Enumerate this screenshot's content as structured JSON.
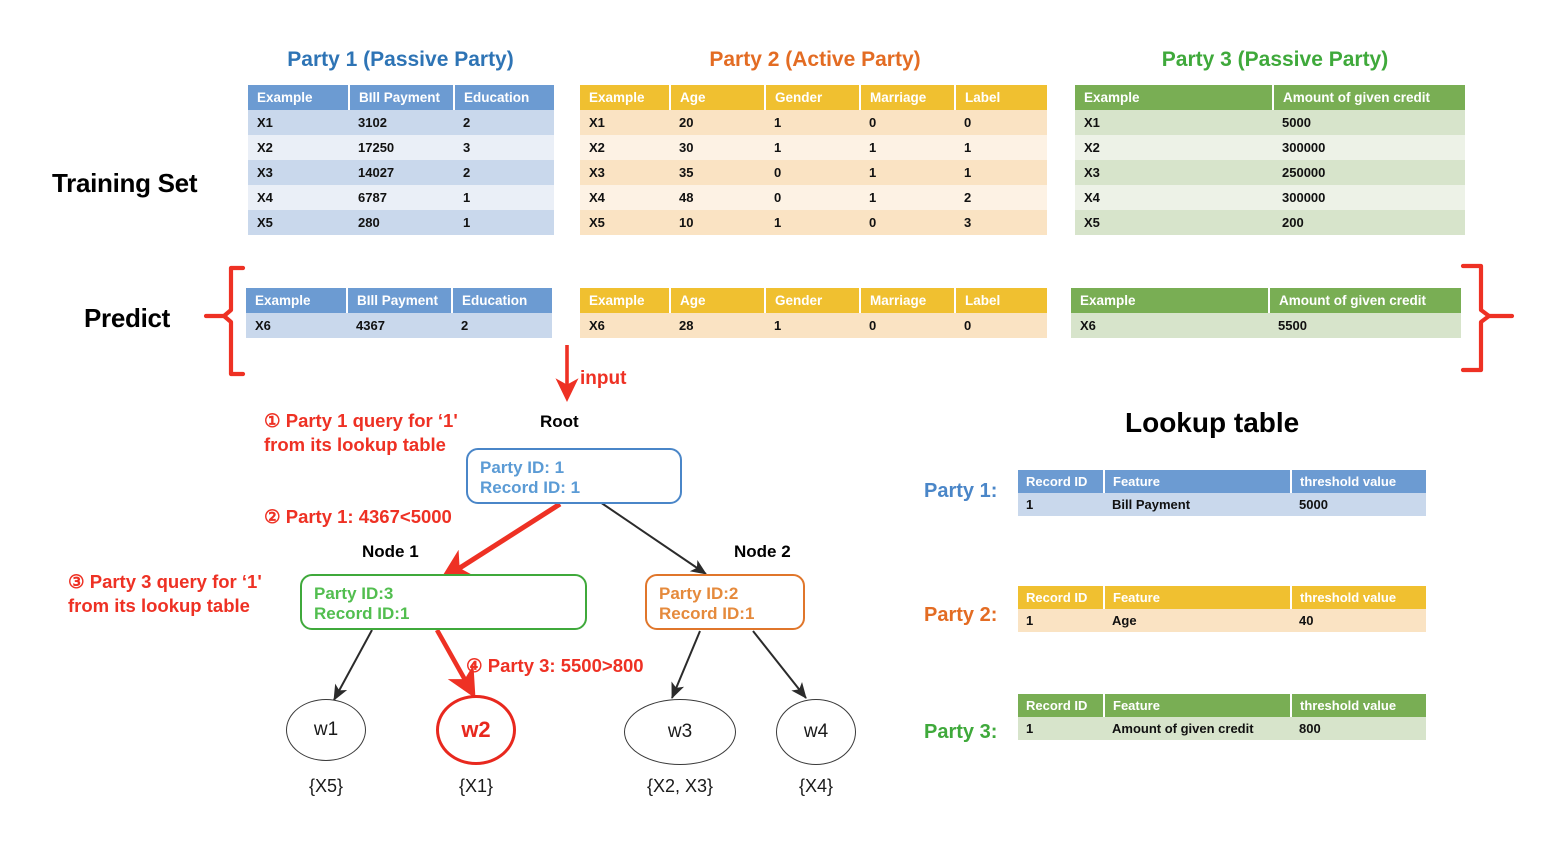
{
  "row_labels": {
    "training_set": "Training Set",
    "predict": "Predict"
  },
  "parties": [
    {
      "title": "Party 1 (Passive Party)",
      "theme": "blue",
      "columns": [
        "Example",
        "BIll Payment",
        "Education"
      ],
      "rows": [
        [
          "X1",
          "3102",
          "2"
        ],
        [
          "X2",
          "17250",
          "3"
        ],
        [
          "X3",
          "14027",
          "2"
        ],
        [
          "X4",
          "6787",
          "1"
        ],
        [
          "X5",
          "280",
          "1"
        ]
      ],
      "predict_rows": [
        [
          "X6",
          "4367",
          "2"
        ]
      ]
    },
    {
      "title": "Party 2 (Active Party)",
      "theme": "yellow",
      "columns": [
        "Example",
        "Age",
        "Gender",
        "Marriage",
        "Label"
      ],
      "rows": [
        [
          "X1",
          "20",
          "1",
          "0",
          "0"
        ],
        [
          "X2",
          "30",
          "1",
          "1",
          "1"
        ],
        [
          "X3",
          "35",
          "0",
          "1",
          "1"
        ],
        [
          "X4",
          "48",
          "0",
          "1",
          "2"
        ],
        [
          "X5",
          "10",
          "1",
          "0",
          "3"
        ]
      ],
      "predict_rows": [
        [
          "X6",
          "28",
          "1",
          "0",
          "0"
        ]
      ]
    },
    {
      "title": "Party 3 (Passive Party)",
      "theme": "green",
      "columns": [
        "Example",
        "Amount of given credit"
      ],
      "rows": [
        [
          "X1",
          "5000"
        ],
        [
          "X2",
          "300000"
        ],
        [
          "X3",
          "250000"
        ],
        [
          "X4",
          "300000"
        ],
        [
          "X5",
          "200"
        ]
      ],
      "predict_rows": [
        [
          "X6",
          "5500"
        ]
      ]
    }
  ],
  "flow": {
    "input_label": "input"
  },
  "tree": {
    "root": {
      "caption": "Root",
      "line1": "Party ID: 1",
      "line2": "Record ID: 1"
    },
    "node1": {
      "caption": "Node 1",
      "line1": "Party ID:3",
      "line2": "Record ID:1"
    },
    "node2": {
      "caption": "Node 2",
      "line1": "Party ID:2",
      "line2": "Record ID:1"
    },
    "leaves": [
      {
        "name": "w1",
        "set": "{X5}",
        "highlighted": false
      },
      {
        "name": "w2",
        "set": "{X1}",
        "highlighted": true
      },
      {
        "name": "w3",
        "set": "{X2, X3}",
        "highlighted": false
      },
      {
        "name": "w4",
        "set": "{X4}",
        "highlighted": false
      }
    ]
  },
  "annotations": [
    {
      "id": "step1",
      "line1": "① Party  1 query for ‘1'",
      "line2": "from its lookup table"
    },
    {
      "id": "step2",
      "line1": "② Party  1: 4367<5000",
      "line2": ""
    },
    {
      "id": "step3",
      "line1": "③ Party 3 query for ‘1'",
      "line2": "from its lookup table"
    },
    {
      "id": "step4",
      "line1": "④ Party  3: 5500>800",
      "line2": ""
    }
  ],
  "lookup": {
    "heading": "Lookup table",
    "columns": [
      "Record ID",
      "Feature",
      "threshold value"
    ],
    "tables": [
      {
        "tag": "Party 1:",
        "theme": "blue",
        "row": [
          "1",
          "Bill Payment",
          "5000"
        ]
      },
      {
        "tag": "Party 2:",
        "theme": "yellow",
        "row": [
          "1",
          "Age",
          "40"
        ]
      },
      {
        "tag": "Party 3:",
        "theme": "green",
        "row": [
          "1",
          "Amount of given credit",
          "800"
        ]
      }
    ]
  },
  "colors": {
    "blue": "#6C9BD2",
    "yellow": "#F0C030",
    "green": "#79AE54",
    "red": "#EE3124",
    "title_blue": "#2E74B5",
    "title_orange": "#E36C23",
    "title_green": "#3FA93B"
  }
}
